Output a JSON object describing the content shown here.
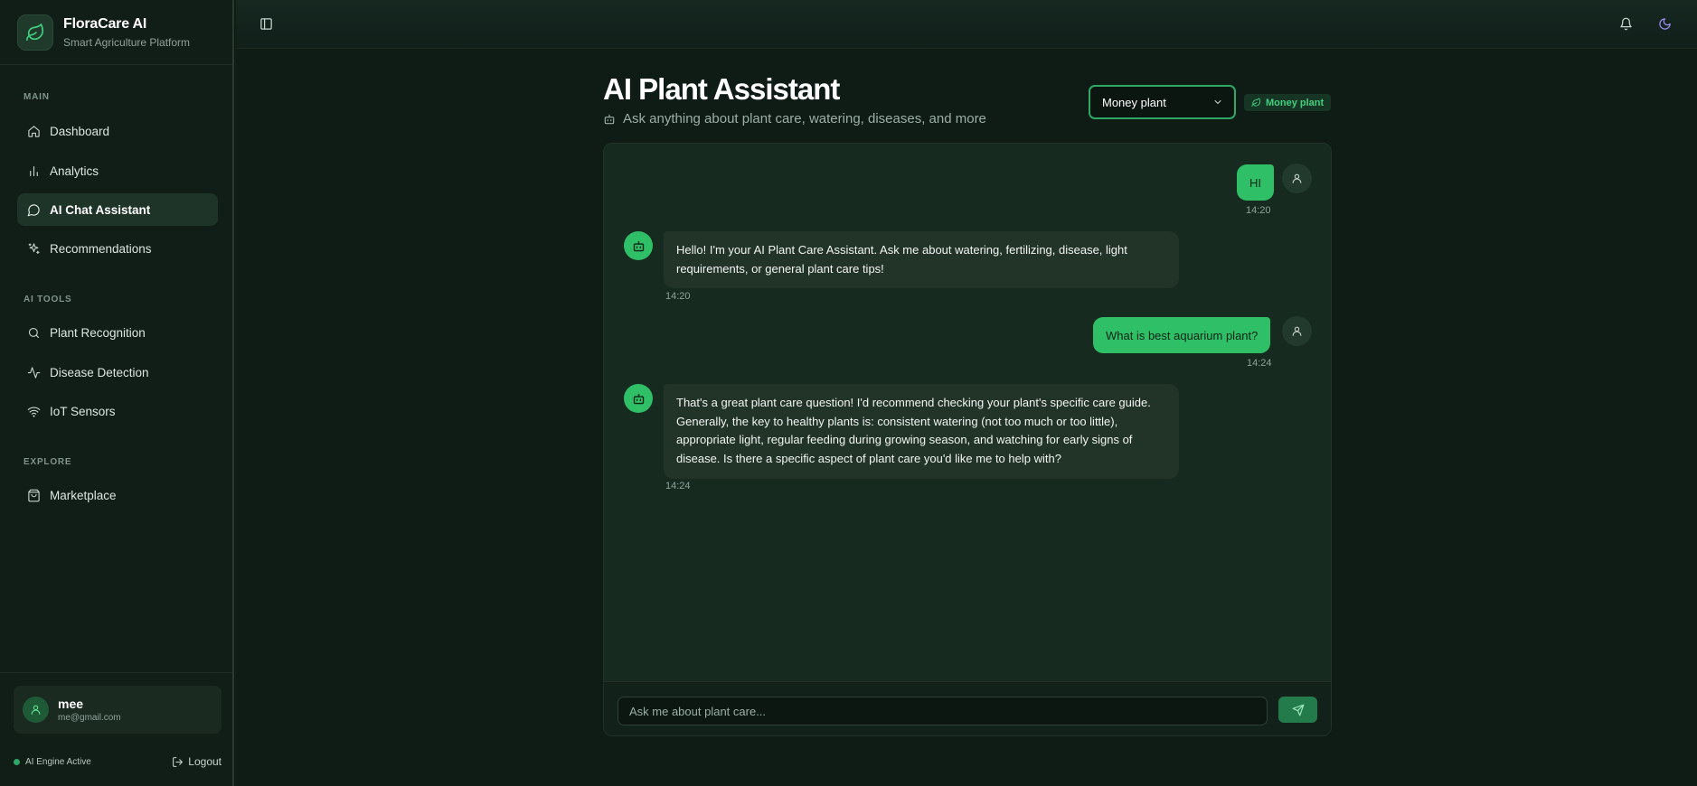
{
  "brand": {
    "title": "FloraCare AI",
    "subtitle": "Smart Agriculture Platform"
  },
  "nav": {
    "section_main": "MAIN",
    "section_ai_tools": "AI TOOLS",
    "section_explore": "EXPLORE",
    "items": [
      {
        "label": "Dashboard",
        "icon": "home-icon"
      },
      {
        "label": "Analytics",
        "icon": "bar-chart-icon"
      },
      {
        "label": "AI Chat Assistant",
        "icon": "chat-icon",
        "active": true
      },
      {
        "label": "Recommendations",
        "icon": "sparkles-icon"
      },
      {
        "label": "Plant Recognition",
        "icon": "search-icon"
      },
      {
        "label": "Disease Detection",
        "icon": "activity-icon"
      },
      {
        "label": "IoT Sensors",
        "icon": "wifi-icon"
      },
      {
        "label": "Marketplace",
        "icon": "shopping-bag-icon"
      }
    ]
  },
  "user": {
    "name": "mee",
    "email": "me@gmail.com"
  },
  "footer": {
    "status": "AI Engine Active",
    "logout": "Logout"
  },
  "header": {
    "title": "AI Plant Assistant",
    "subtitle": "Ask anything about plant care, watering, diseases, and more",
    "selected_plant": "Money plant",
    "plant_badge": "Money plant"
  },
  "messages": [
    {
      "role": "user",
      "text": "HI",
      "time": "14:20"
    },
    {
      "role": "bot",
      "text": "Hello! I'm your AI Plant Care Assistant. Ask me about watering, fertilizing, disease, light requirements, or general plant care tips!",
      "time": "14:20"
    },
    {
      "role": "user",
      "text": "What is best aquarium plant?",
      "time": "14:24"
    },
    {
      "role": "bot",
      "text": "That's a great plant care question! I'd recommend checking your plant's specific care guide. Generally, the key to healthy plants is: consistent watering (not too much or too little), appropriate light, regular feeding during growing season, and watching for early signs of disease. Is there a specific aspect of plant care you'd like me to help with?",
      "time": "14:24"
    }
  ],
  "composer": {
    "placeholder": "Ask me about plant care..."
  },
  "colors": {
    "accent": "#2fbf66",
    "background": "#0f1b15",
    "sidebar": "#111e17",
    "panel": "#172a20"
  }
}
